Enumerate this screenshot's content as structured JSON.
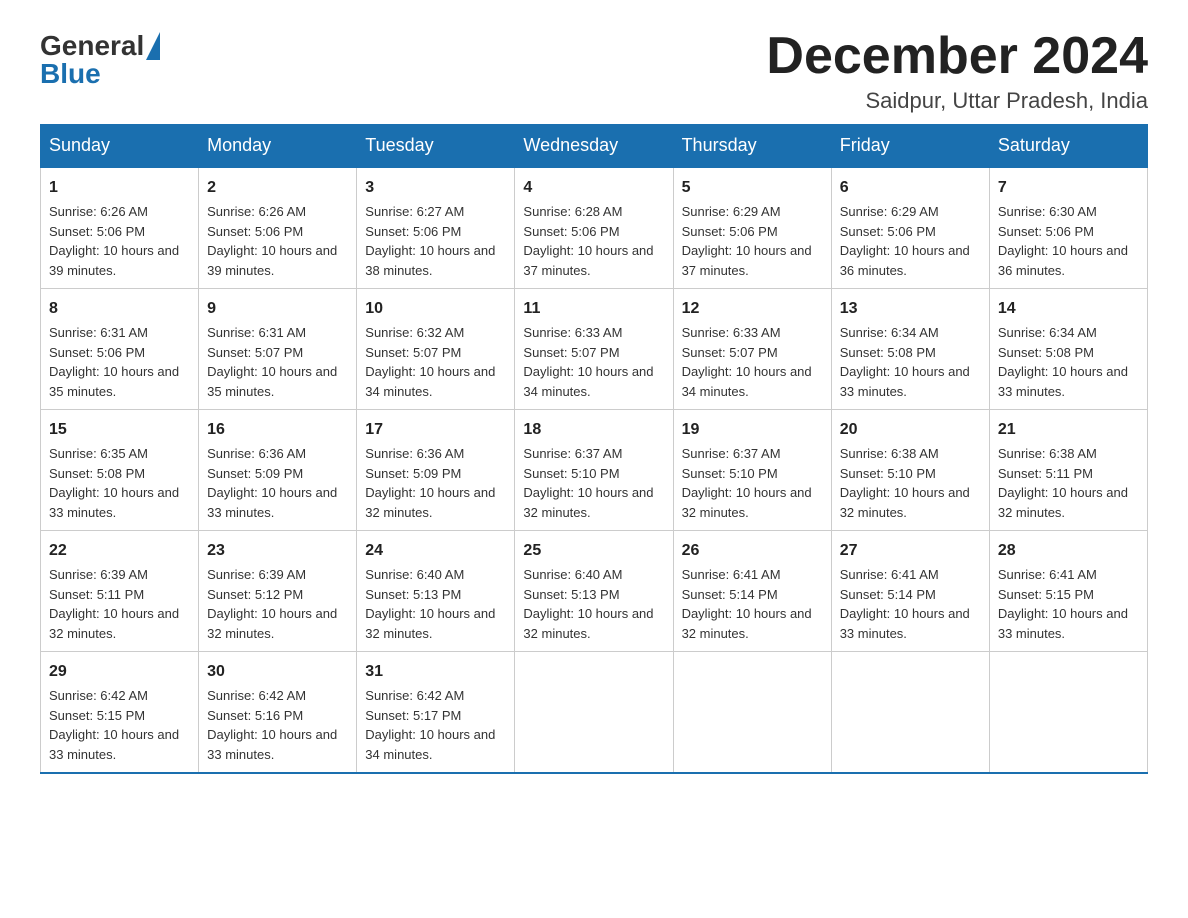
{
  "header": {
    "logo_general": "General",
    "logo_blue": "Blue",
    "month_title": "December 2024",
    "location": "Saidpur, Uttar Pradesh, India"
  },
  "weekdays": [
    "Sunday",
    "Monday",
    "Tuesday",
    "Wednesday",
    "Thursday",
    "Friday",
    "Saturday"
  ],
  "weeks": [
    [
      {
        "day": "1",
        "sunrise": "6:26 AM",
        "sunset": "5:06 PM",
        "daylight": "10 hours and 39 minutes."
      },
      {
        "day": "2",
        "sunrise": "6:26 AM",
        "sunset": "5:06 PM",
        "daylight": "10 hours and 39 minutes."
      },
      {
        "day": "3",
        "sunrise": "6:27 AM",
        "sunset": "5:06 PM",
        "daylight": "10 hours and 38 minutes."
      },
      {
        "day": "4",
        "sunrise": "6:28 AM",
        "sunset": "5:06 PM",
        "daylight": "10 hours and 37 minutes."
      },
      {
        "day": "5",
        "sunrise": "6:29 AM",
        "sunset": "5:06 PM",
        "daylight": "10 hours and 37 minutes."
      },
      {
        "day": "6",
        "sunrise": "6:29 AM",
        "sunset": "5:06 PM",
        "daylight": "10 hours and 36 minutes."
      },
      {
        "day": "7",
        "sunrise": "6:30 AM",
        "sunset": "5:06 PM",
        "daylight": "10 hours and 36 minutes."
      }
    ],
    [
      {
        "day": "8",
        "sunrise": "6:31 AM",
        "sunset": "5:06 PM",
        "daylight": "10 hours and 35 minutes."
      },
      {
        "day": "9",
        "sunrise": "6:31 AM",
        "sunset": "5:07 PM",
        "daylight": "10 hours and 35 minutes."
      },
      {
        "day": "10",
        "sunrise": "6:32 AM",
        "sunset": "5:07 PM",
        "daylight": "10 hours and 34 minutes."
      },
      {
        "day": "11",
        "sunrise": "6:33 AM",
        "sunset": "5:07 PM",
        "daylight": "10 hours and 34 minutes."
      },
      {
        "day": "12",
        "sunrise": "6:33 AM",
        "sunset": "5:07 PM",
        "daylight": "10 hours and 34 minutes."
      },
      {
        "day": "13",
        "sunrise": "6:34 AM",
        "sunset": "5:08 PM",
        "daylight": "10 hours and 33 minutes."
      },
      {
        "day": "14",
        "sunrise": "6:34 AM",
        "sunset": "5:08 PM",
        "daylight": "10 hours and 33 minutes."
      }
    ],
    [
      {
        "day": "15",
        "sunrise": "6:35 AM",
        "sunset": "5:08 PM",
        "daylight": "10 hours and 33 minutes."
      },
      {
        "day": "16",
        "sunrise": "6:36 AM",
        "sunset": "5:09 PM",
        "daylight": "10 hours and 33 minutes."
      },
      {
        "day": "17",
        "sunrise": "6:36 AM",
        "sunset": "5:09 PM",
        "daylight": "10 hours and 32 minutes."
      },
      {
        "day": "18",
        "sunrise": "6:37 AM",
        "sunset": "5:10 PM",
        "daylight": "10 hours and 32 minutes."
      },
      {
        "day": "19",
        "sunrise": "6:37 AM",
        "sunset": "5:10 PM",
        "daylight": "10 hours and 32 minutes."
      },
      {
        "day": "20",
        "sunrise": "6:38 AM",
        "sunset": "5:10 PM",
        "daylight": "10 hours and 32 minutes."
      },
      {
        "day": "21",
        "sunrise": "6:38 AM",
        "sunset": "5:11 PM",
        "daylight": "10 hours and 32 minutes."
      }
    ],
    [
      {
        "day": "22",
        "sunrise": "6:39 AM",
        "sunset": "5:11 PM",
        "daylight": "10 hours and 32 minutes."
      },
      {
        "day": "23",
        "sunrise": "6:39 AM",
        "sunset": "5:12 PM",
        "daylight": "10 hours and 32 minutes."
      },
      {
        "day": "24",
        "sunrise": "6:40 AM",
        "sunset": "5:13 PM",
        "daylight": "10 hours and 32 minutes."
      },
      {
        "day": "25",
        "sunrise": "6:40 AM",
        "sunset": "5:13 PM",
        "daylight": "10 hours and 32 minutes."
      },
      {
        "day": "26",
        "sunrise": "6:41 AM",
        "sunset": "5:14 PM",
        "daylight": "10 hours and 32 minutes."
      },
      {
        "day": "27",
        "sunrise": "6:41 AM",
        "sunset": "5:14 PM",
        "daylight": "10 hours and 33 minutes."
      },
      {
        "day": "28",
        "sunrise": "6:41 AM",
        "sunset": "5:15 PM",
        "daylight": "10 hours and 33 minutes."
      }
    ],
    [
      {
        "day": "29",
        "sunrise": "6:42 AM",
        "sunset": "5:15 PM",
        "daylight": "10 hours and 33 minutes."
      },
      {
        "day": "30",
        "sunrise": "6:42 AM",
        "sunset": "5:16 PM",
        "daylight": "10 hours and 33 minutes."
      },
      {
        "day": "31",
        "sunrise": "6:42 AM",
        "sunset": "5:17 PM",
        "daylight": "10 hours and 34 minutes."
      },
      null,
      null,
      null,
      null
    ]
  ]
}
